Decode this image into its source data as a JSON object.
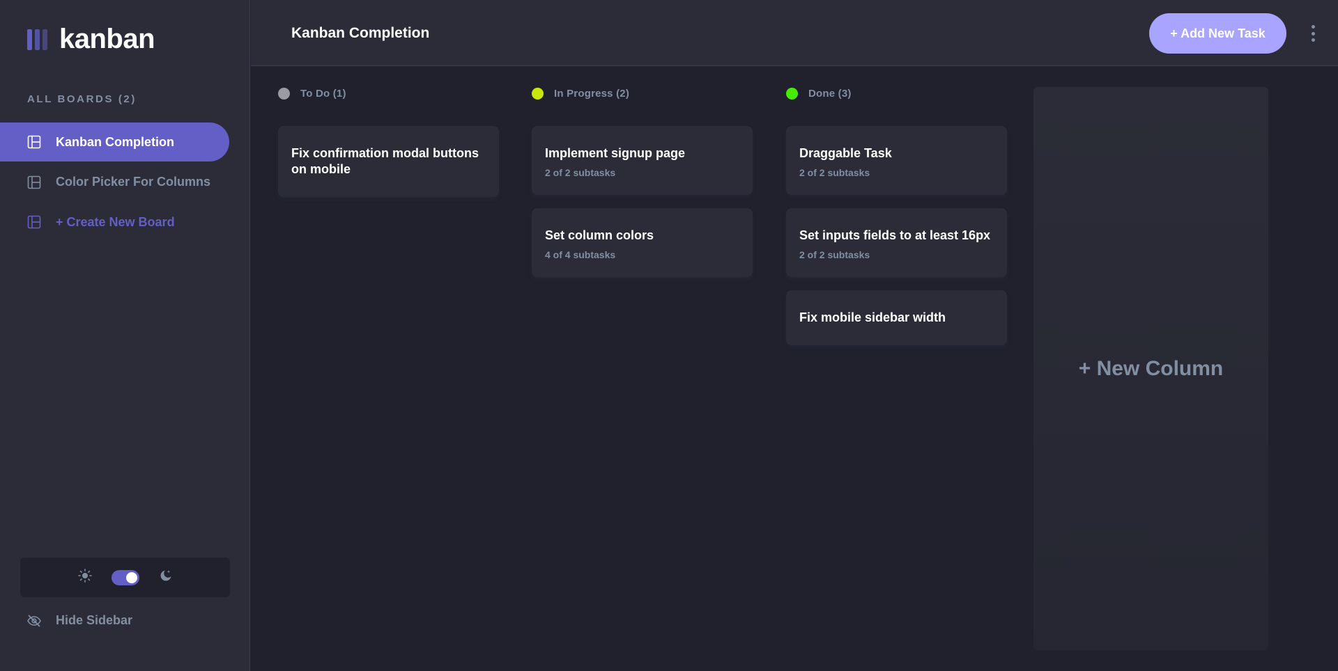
{
  "app": {
    "logo_text": "kanban"
  },
  "sidebar": {
    "heading": "ALL BOARDS (2)",
    "boards": [
      {
        "label": "Kanban Completion",
        "active": true
      },
      {
        "label": "Color Picker For Columns",
        "active": false
      }
    ],
    "create_label": "+ Create New Board",
    "theme": {
      "mode": "dark",
      "toggle_on": true
    },
    "hide_label": "Hide Sidebar"
  },
  "header": {
    "title": "Kanban Completion",
    "add_task_label": "+ Add New Task"
  },
  "columns": [
    {
      "title": "To Do (1)",
      "color": "#9b9ca1",
      "tasks": [
        {
          "title": "Fix confirmation modal buttons on mobile",
          "subtasks": ""
        }
      ]
    },
    {
      "title": "In Progress (2)",
      "color": "#c9e70d",
      "tasks": [
        {
          "title": "Implement signup page",
          "subtasks": "2 of 2 subtasks"
        },
        {
          "title": "Set column colors",
          "subtasks": "4 of 4 subtasks"
        }
      ]
    },
    {
      "title": "Done (3)",
      "color": "#46ec08",
      "tasks": [
        {
          "title": "Draggable Task",
          "subtasks": "2 of 2 subtasks"
        },
        {
          "title": "Set inputs fields to at least 16px",
          "subtasks": "2 of 2 subtasks"
        },
        {
          "title": "Fix mobile sidebar width",
          "subtasks": ""
        }
      ]
    }
  ],
  "new_column_label": "+ New Column",
  "colors": {
    "accent": "#635fc7",
    "accent_light": "#a8a4ff",
    "panel": "#2b2c37",
    "background": "#20212c",
    "muted_text": "#828fa3"
  }
}
